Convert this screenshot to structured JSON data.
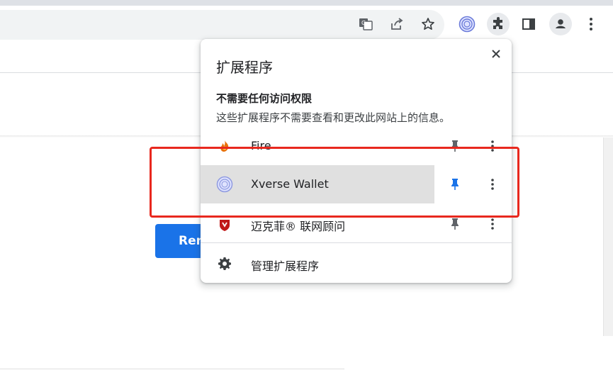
{
  "toolbar": {
    "icons": [
      "translate-icon",
      "share-icon",
      "bookmark-star-icon",
      "xverse-extension-icon",
      "extensions-puzzle-icon",
      "side-panel-icon",
      "profile-avatar-icon",
      "chrome-menu-icon"
    ]
  },
  "page": {
    "button_label": "Ren"
  },
  "extensions_popup": {
    "title": "扩展程序",
    "close_icon": "close-icon",
    "section_title": "不需要任何访问权限",
    "section_description": "这些扩展程序不需要查看和更改此网站上的信息。",
    "items": [
      {
        "name": "Fire",
        "icon": "fire-extension-icon",
        "pinned": false
      },
      {
        "name": "Xverse Wallet",
        "icon": "xverse-wallet-icon",
        "pinned": true,
        "highlighted": true
      },
      {
        "name": "迈克菲® 联网顾问",
        "icon": "mcafee-shield-icon",
        "pinned": false
      }
    ],
    "manage_label": "管理扩展程序",
    "manage_icon": "gear-icon"
  },
  "colors": {
    "highlight_box": "#e8281e",
    "pin_active": "#1a73e8",
    "pin_inactive": "#5f6368",
    "button_blue": "#1a73e8"
  }
}
